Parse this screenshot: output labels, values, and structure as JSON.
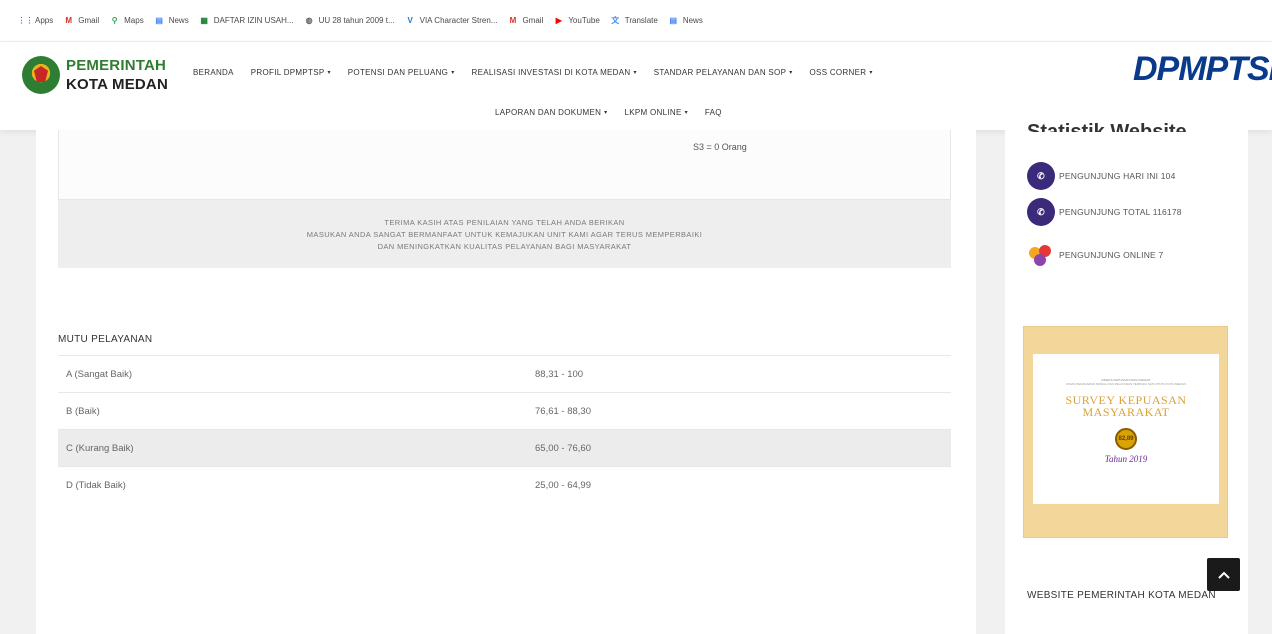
{
  "bookmarks": [
    {
      "label": "Apps",
      "icon": "apps-grid-icon",
      "color": "#4285f4"
    },
    {
      "label": "Gmail",
      "icon": "gmail-icon",
      "color": "#d93025"
    },
    {
      "label": "Maps",
      "icon": "maps-pin-icon",
      "color": "#34a853"
    },
    {
      "label": "News",
      "icon": "news-icon",
      "color": "#4285f4"
    },
    {
      "label": "DAFTAR IZIN USAH...",
      "icon": "sheets-icon",
      "color": "#188038"
    },
    {
      "label": "UU 28 tahun 2009 t...",
      "icon": "globe-icon",
      "color": "#5f6368"
    },
    {
      "label": "VIA Character Stren...",
      "icon": "via-icon",
      "color": "#1976d2"
    },
    {
      "label": "Gmail",
      "icon": "gmail-icon",
      "color": "#d93025"
    },
    {
      "label": "YouTube",
      "icon": "youtube-icon",
      "color": "#ff0000"
    },
    {
      "label": "Translate",
      "icon": "translate-icon",
      "color": "#4285f4"
    },
    {
      "label": "News",
      "icon": "news-icon",
      "color": "#4285f4"
    }
  ],
  "header": {
    "logo_line1": "PEMERINTAH",
    "logo_line2": "KOTA MEDAN",
    "brand": "DPMPTSP",
    "nav_row1": [
      {
        "label": "BERANDA",
        "dropdown": false
      },
      {
        "label": "PROFIL DPMPTSP",
        "dropdown": true
      },
      {
        "label": "POTENSI DAN PELUANG",
        "dropdown": true
      },
      {
        "label": "REALISASI INVESTASI DI KOTA MEDAN",
        "dropdown": true
      },
      {
        "label": "STANDAR PELAYANAN DAN SOP",
        "dropdown": true
      },
      {
        "label": "OSS CORNER",
        "dropdown": true
      }
    ],
    "nav_row2": [
      {
        "label": "LAPORAN DAN DOKUMEN",
        "dropdown": true
      },
      {
        "label": "LKPM ONLINE",
        "dropdown": true
      },
      {
        "label": "FAQ",
        "dropdown": false
      }
    ],
    "caret": "▾"
  },
  "main": {
    "rating_line": "S3 = 0 Orang",
    "thanks_lines": [
      "TERIMA KASIH ATAS PENILAIAN YANG TELAH ANDA BERIKAN",
      "MASUKAN ANDA SANGAT BERMANFAAT UNTUK KEMAJUKAN UNIT KAMI AGAR TERUS MEMPERBAIKI",
      "DAN MENINGKATKAN KUALITAS PELAYANAN BAGI MASYARAKAT"
    ],
    "mutu_title": "MUTU PELAYANAN",
    "mutu_rows": [
      {
        "grade": "A (Sangat Baik)",
        "range": "88,31 - 100"
      },
      {
        "grade": "B (Baik)",
        "range": "76,61 - 88,30"
      },
      {
        "grade": "C (Kurang Baik)",
        "range": "65,00 - 76,60"
      },
      {
        "grade": "D (Tidak Baik)",
        "range": "25,00 - 64,99"
      }
    ]
  },
  "sidebar": {
    "stat_title": "Statistik Website",
    "stats": [
      {
        "label": "PENGUNJUNG HARI INI 104",
        "icon": "visitors-today-icon"
      },
      {
        "label": "PENGUNJUNG TOTAL 116178",
        "icon": "visitors-total-icon"
      },
      {
        "label": "PENGUNJUNG ONLINE 7",
        "icon": "visitors-online-icon"
      }
    ],
    "banner": {
      "header": "INDEKS KEPUASAN MASYARAKAT",
      "subheader": "DINAS PENANAMAN MODAL DAN PELAYANAN TERPADU SATU PINTU KOTA MEDAN",
      "title_line1": "SURVEY KEPUASAN",
      "title_line2": "MASYARAKAT",
      "score": "82,89",
      "year": "Tahun 2019"
    },
    "web_title": "WEBSITE PEMERINTAH KOTA MEDAN",
    "scroll_top_icon": "chevron-up-icon"
  }
}
